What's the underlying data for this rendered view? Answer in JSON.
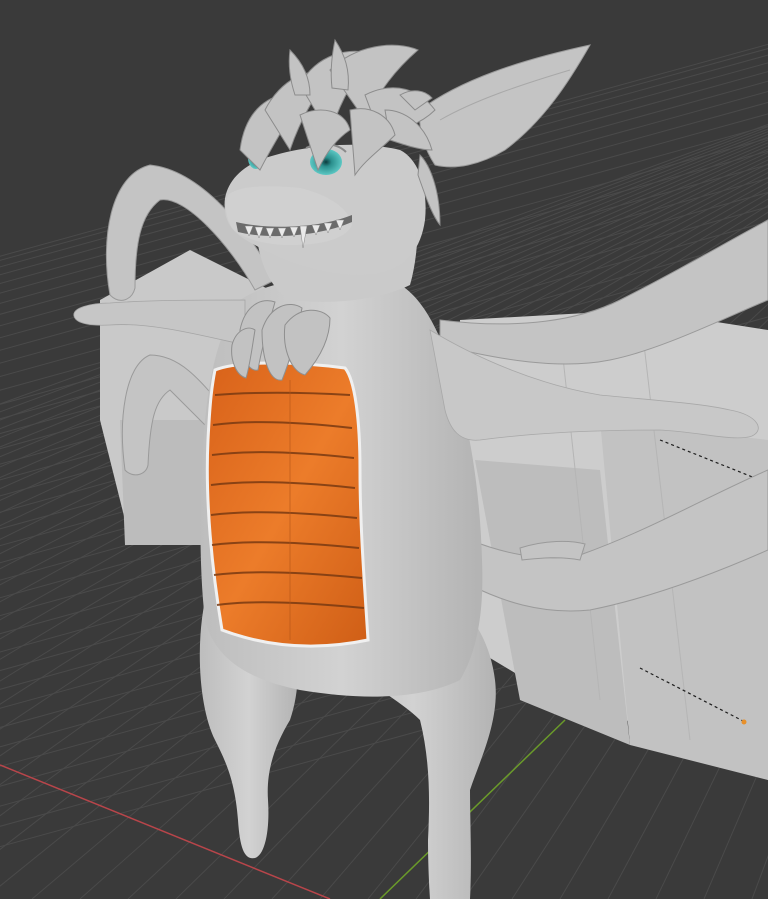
{
  "viewport": {
    "background_color": "#3a3a3a",
    "grid_color": "#4a4a4a",
    "x_axis_color": "#c44a4a",
    "y_axis_color": "#6a9a2a"
  },
  "model": {
    "body_color": "#c9c9c9",
    "body_shade_color": "#9e9e9e",
    "chest_color": "#e0701e",
    "chest_line_color": "#7a3a12",
    "eye_color": "#3fb3b0",
    "backdrop_color": "#cfcfcf",
    "light_point_color": "#e8902a"
  }
}
